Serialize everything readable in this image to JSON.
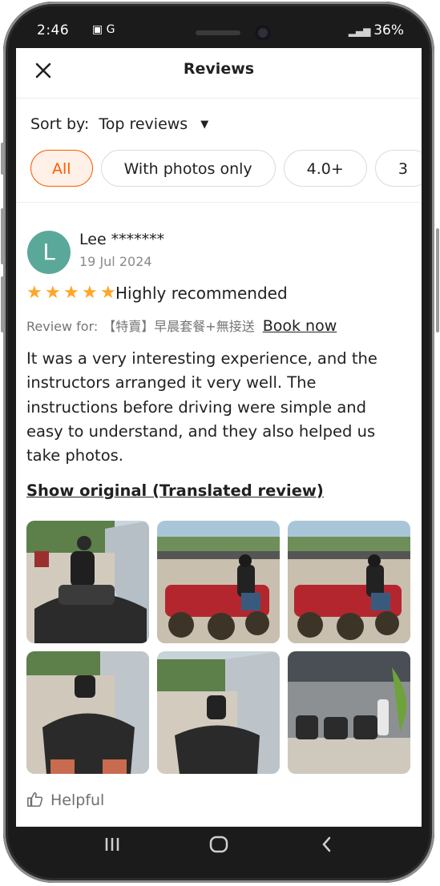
{
  "statusbar": {
    "time": "2:46",
    "left_icons": "▣ G",
    "right_text": "36%"
  },
  "header": {
    "title": "Reviews",
    "close_icon": "close-icon"
  },
  "sort": {
    "label": "Sort by:",
    "value": "Top reviews"
  },
  "filters": [
    {
      "label": "All",
      "active": true
    },
    {
      "label": "With photos only",
      "active": false
    },
    {
      "label": "4.0+",
      "active": false
    },
    {
      "label": "3",
      "active": false
    }
  ],
  "review": {
    "avatar_letter": "L",
    "user_name": "Lee *******",
    "date": "19 Jul 2024",
    "rating": 5,
    "headline": "Highly recommended",
    "review_for_label": "Review for:",
    "product": "【特賣】早晨套餐+無接送",
    "book_now": "Book now",
    "body": "It was a very interesting experience, and the instructors arranged it very well. The instructions before driving were simple and easy to understand, and they also helped us take photos.",
    "show_original": "Show original (Translated review)",
    "photo_count": 6,
    "helpful_label": "Helpful"
  },
  "colors": {
    "accent": "#ff5b00",
    "star": "#ffa628",
    "avatar": "#5aa899"
  },
  "navbar": {
    "recent_icon": "recent-apps-icon",
    "home_icon": "home-icon",
    "back_icon": "back-icon"
  }
}
